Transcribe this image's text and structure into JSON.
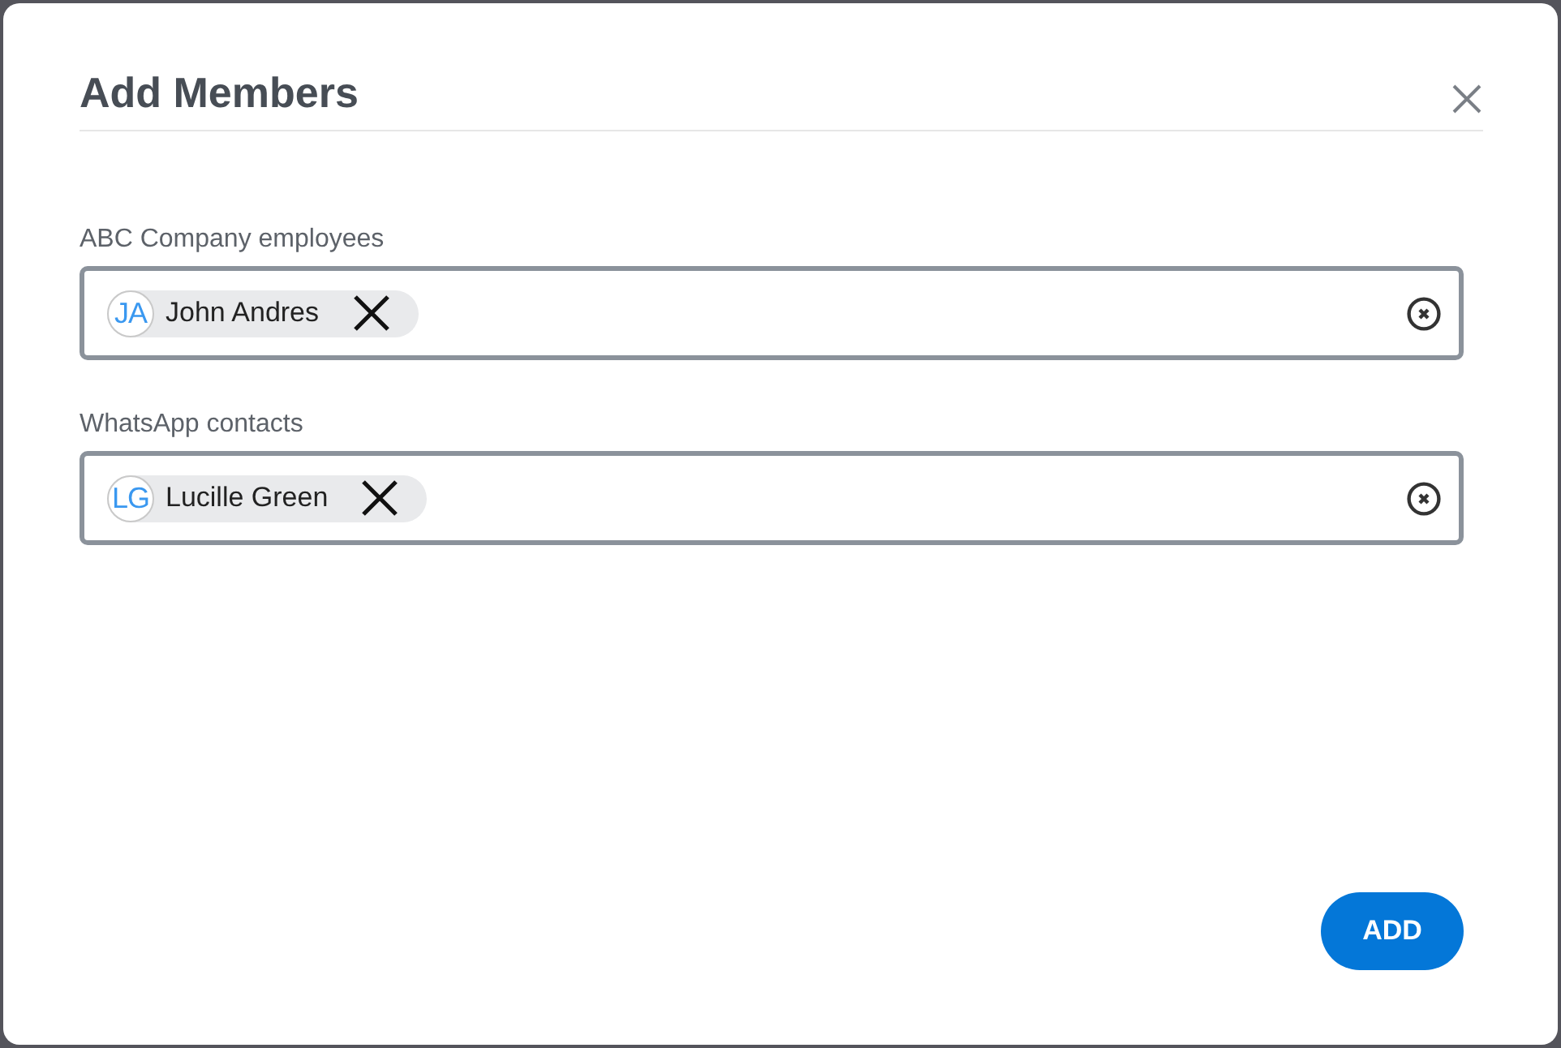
{
  "dialog": {
    "title": "Add Members"
  },
  "fields": [
    {
      "label": "ABC Company employees",
      "chips": [
        {
          "initials": "JA",
          "name": "John Andres"
        }
      ]
    },
    {
      "label": "WhatsApp contacts",
      "chips": [
        {
          "initials": "LG",
          "name": "Lucille Green"
        }
      ]
    }
  ],
  "buttons": [
    {
      "label": "ADD"
    }
  ]
}
